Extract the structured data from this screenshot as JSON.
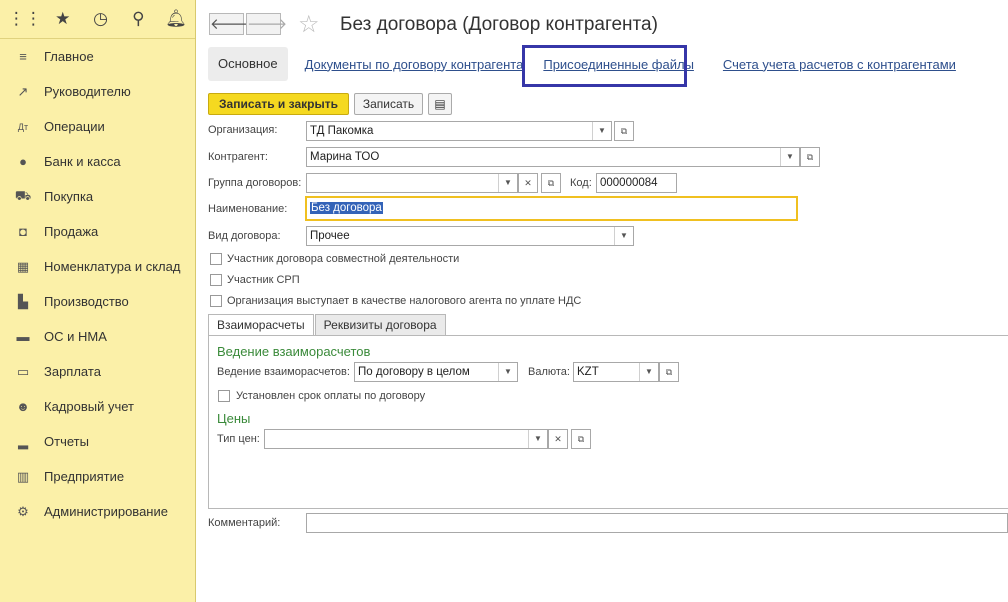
{
  "window": {
    "title": "Без договора (Договор контрагента)"
  },
  "sidebar": {
    "top_icons": [
      "apps-grid-icon",
      "star-icon",
      "history-icon",
      "search-icon",
      "bell-icon"
    ],
    "items": [
      {
        "label": "Главное",
        "icon": "menu-icon"
      },
      {
        "label": "Руководителю",
        "icon": "trend-icon"
      },
      {
        "label": "Операции",
        "icon": "dt-kt-icon"
      },
      {
        "label": "Банк и касса",
        "icon": "coin-icon"
      },
      {
        "label": "Покупка",
        "icon": "cart-icon"
      },
      {
        "label": "Продажа",
        "icon": "bag-icon"
      },
      {
        "label": "Номенклатура и склад",
        "icon": "grid-icon"
      },
      {
        "label": "Производство",
        "icon": "factory-icon"
      },
      {
        "label": "ОС и НМА",
        "icon": "truck-icon"
      },
      {
        "label": "Зарплата",
        "icon": "card-icon"
      },
      {
        "label": "Кадровый учет",
        "icon": "people-icon"
      },
      {
        "label": "Отчеты",
        "icon": "bar-chart-icon"
      },
      {
        "label": "Предприятие",
        "icon": "building-icon"
      },
      {
        "label": "Администрирование",
        "icon": "gear-icon"
      }
    ]
  },
  "tabs": {
    "main": "Основное",
    "links": [
      "Документы по договору контрагента",
      "Присоединенные файлы",
      "Счета учета расчетов с контрагентами"
    ]
  },
  "toolbar": {
    "save_close": "Записать и закрыть",
    "save": "Записать"
  },
  "form": {
    "org_label": "Организация:",
    "org_value": "ТД Пакомка",
    "contractor_label": "Контрагент:",
    "contractor_value": "Марина ТОО",
    "group_label": "Группа договоров:",
    "group_value": "",
    "code_label": "Код:",
    "code_value": "000000084",
    "name_label": "Наименование:",
    "name_value": "Без договора",
    "type_label": "Вид договора:",
    "type_value": "Прочее",
    "chk1": "Участник договора совместной деятельности",
    "chk2": "Участник СРП",
    "chk3": "Организация выступает в качестве налогового агента по уплате НДС",
    "comment_label": "Комментарий:",
    "comment_value": ""
  },
  "inner_tabs": [
    "Взаиморасчеты",
    "Реквизиты договора"
  ],
  "settlements": {
    "section_title": "Ведение взаиморасчетов",
    "mode_label": "Ведение взаиморасчетов:",
    "mode_value": "По договору в целом",
    "currency_label": "Валюта:",
    "currency_value": "KZT",
    "due_chk": "Установлен срок оплаты по договору",
    "prices_title": "Цены",
    "price_type_label": "Тип цен:",
    "price_type_value": ""
  }
}
